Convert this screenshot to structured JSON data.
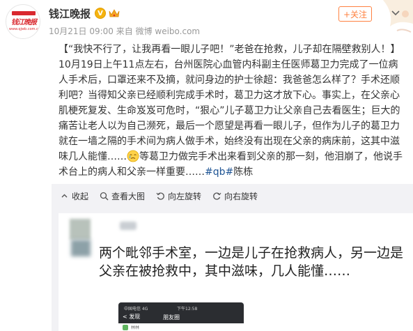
{
  "header": {
    "account_name": "钱江晚报",
    "verified_badge": "V",
    "logo_text": "钱江晚报",
    "logo_sub": "www.qjwb.com.cn",
    "meta": "10月21日 09:00 来自 微博 weibo.com",
    "follow_label": "+关注",
    "more_icon": "chevron-down-icon",
    "brand_color": "#ff8140"
  },
  "post": {
    "line1": "【“我快不行了，让我再看一眼儿子吧！”老爸在抢救，儿子却在隔壁救别人！】",
    "body_part1": "10月19日上午11点左右，台州医院心血管内科副主任医师葛卫力完成了一位病人手术后，口罩还来不及摘，就问身边的护士徐超：我爸爸怎么样了？手术还顺利吧？当得知父亲已经顺利完成手术时，葛卫力这才放下心。事实上，在父亲心肌梗死复发、生命岌岌可危时，“狠心”儿子葛卫力让父亲自己去看医生；巨大的痛苦让老人以为自己濒死，最后一个愿望是再看一眼儿子，但作为儿子的葛卫力就在一墙之隔的手术间为病人做手术，始终没有出现在父亲的病床前，这其中滋味几人能懂……",
    "emoji_name": "tearful-face-emoji",
    "body_part2": "等葛卫力做完手术出来看到父亲的那一刻，他泪崩了，他说手术台上的病人和父亲一样重要……",
    "hashtag": "#qb#",
    "author": "陈栋",
    "link_color": "#1e5494"
  },
  "toolbar": {
    "collapse": "收起",
    "view_large": "查看大图",
    "rotate_left": "向左旋转",
    "rotate_right": "向右旋转"
  },
  "image": {
    "caption": "两个毗邻手术室，一边是儿子在抢救病人，另一边是父亲在被抢救中，其中滋味，几人能懂……",
    "phone_status": "中国电信 4G",
    "phone_time": "下午12:58",
    "phone_title": "朋友圈",
    "phone_back": "< 发现",
    "phone_row": "林林"
  }
}
